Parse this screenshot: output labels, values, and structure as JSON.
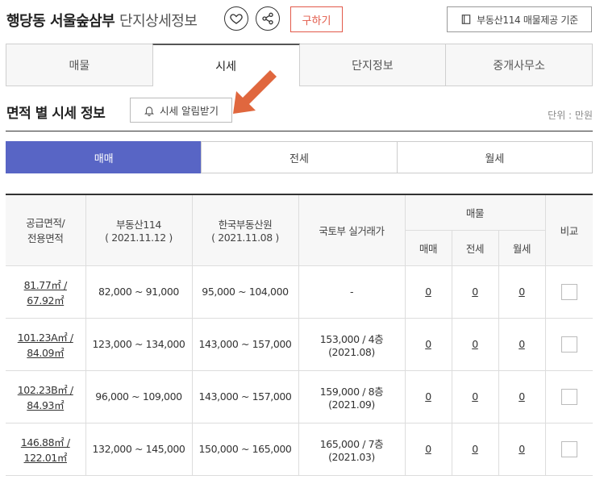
{
  "header": {
    "title_main": "행당동 서울숲삼부",
    "title_sub": "단지상세정보",
    "buy_label": "구하기",
    "source_label": "부동산114 매물제공 기준"
  },
  "tabs": [
    "매물",
    "시세",
    "단지정보",
    "중개사무소"
  ],
  "section": {
    "title": "면적 별 시세 정보",
    "alert_label": "시세 알림받기",
    "unit": "단위 : 만원"
  },
  "deal_tabs": [
    "매매",
    "전세",
    "월세"
  ],
  "table": {
    "headers": {
      "area_line1": "공급면적/",
      "area_line2": "전용면적",
      "r114": "부동산114",
      "r114_date": "( 2021.11.12 )",
      "kab": "한국부동산원",
      "kab_date": "( 2021.11.08 )",
      "molit": "국토부 실거래가",
      "listing": "매물",
      "sale": "매매",
      "jeonse": "전세",
      "monthly": "월세",
      "compare": "비교"
    },
    "rows": [
      {
        "area1": "81.77㎡ /",
        "area2": "67.92㎡",
        "r114": "82,000 ~ 91,000",
        "kab": "95,000 ~ 104,000",
        "molit1": "-",
        "molit2": "",
        "sale": "0",
        "jeonse": "0",
        "monthly": "0"
      },
      {
        "area1": "101.23A㎡ /",
        "area2": "84.09㎡",
        "r114": "123,000 ~ 134,000",
        "kab": "143,000 ~ 157,000",
        "molit1": "153,000 / 4층",
        "molit2": "(2021.08)",
        "sale": "0",
        "jeonse": "0",
        "monthly": "0"
      },
      {
        "area1": "102.23B㎡ /",
        "area2": "84.93㎡",
        "r114": "96,000 ~ 109,000",
        "kab": "143,000 ~ 157,000",
        "molit1": "159,000 / 8층",
        "molit2": "(2021.09)",
        "sale": "0",
        "jeonse": "0",
        "monthly": "0"
      },
      {
        "area1": "146.88㎡ /",
        "area2": "122.01㎡",
        "r114": "132,000 ~ 145,000",
        "kab": "150,000 ~ 165,000",
        "molit1": "165,000 / 7층",
        "molit2": "(2021.03)",
        "sale": "0",
        "jeonse": "0",
        "monthly": "0"
      }
    ]
  },
  "icons": {
    "heart": "heart-icon",
    "share": "share-icon",
    "book": "book-icon",
    "bell": "bell-icon",
    "arrow": "arrow-pointer-icon"
  },
  "colors": {
    "accent": "#5865c5",
    "buy": "#e25a4a",
    "arrow": "#e0673e"
  }
}
